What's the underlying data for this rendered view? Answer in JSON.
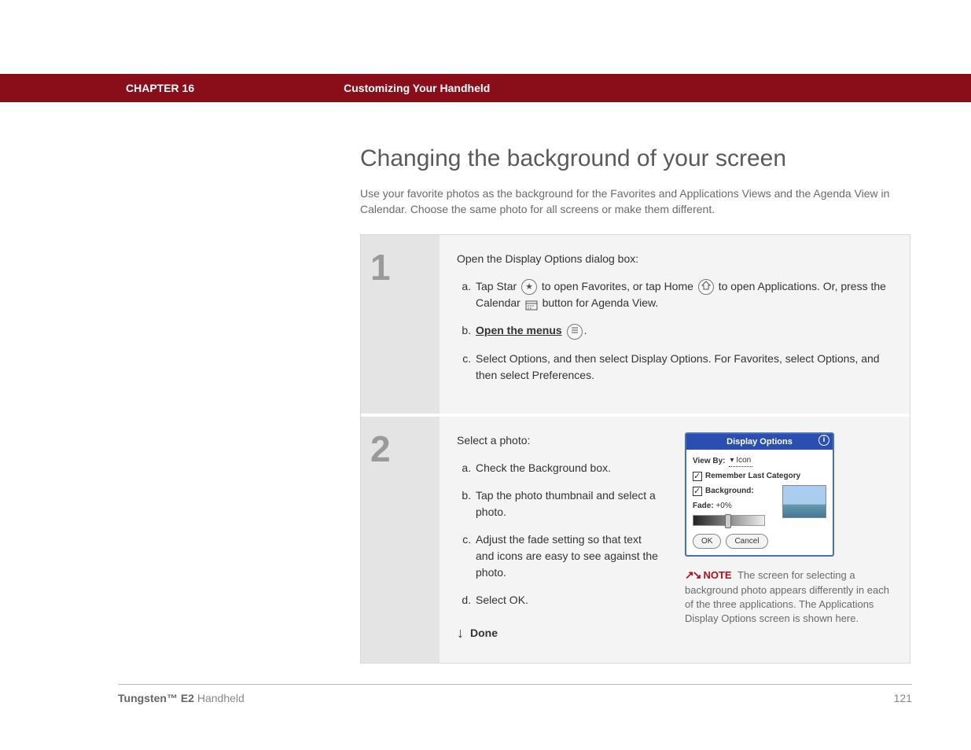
{
  "header": {
    "chapter": "CHAPTER 16",
    "title": "Customizing Your Handheld"
  },
  "page": {
    "heading": "Changing the background of your screen",
    "intro": "Use your favorite photos as the background for the Favorites and Applications Views and the Agenda View in Calendar. Choose the same photo for all screens or make them different."
  },
  "steps": [
    {
      "num": "1",
      "lead": "Open the Display Options dialog box:",
      "items": [
        {
          "pre": "Tap Star ",
          "icon": "star",
          "mid1": " to open Favorites, or tap Home ",
          "icon2": "home",
          "mid2": " to open Applications. Or, press the Calendar ",
          "icon3": "calendar",
          "post": " button for Agenda View."
        },
        {
          "linkText": "Open the menus",
          "icon": "menu",
          "post": "."
        },
        {
          "plain": "Select Options, and then select Display Options. For Favorites, select Options, and then select Preferences."
        }
      ]
    },
    {
      "num": "2",
      "lead": "Select a photo:",
      "items": [
        {
          "plain": "Check the Background box."
        },
        {
          "plain": "Tap the photo thumbnail and select a photo."
        },
        {
          "plain": "Adjust the fade setting so that text and icons are easy to see against the photo."
        },
        {
          "plain": "Select OK."
        }
      ],
      "done": "Done"
    }
  ],
  "device": {
    "title": "Display Options",
    "viewByLabel": "View By:",
    "viewByValue": "Icon",
    "remember": "Remember Last Category",
    "backgroundLabel": "Background:",
    "fadeLabel": "Fade:",
    "fadeValue": "+0%",
    "okLabel": "OK",
    "cancelLabel": "Cancel"
  },
  "note": {
    "badge": "NOTE",
    "text": "The screen for selecting a background photo appears differently in each of the three applications. The Applications Display Options screen is shown here."
  },
  "footer": {
    "productBold": "Tungsten™ E2",
    "productRest": " Handheld",
    "pageNum": "121"
  }
}
